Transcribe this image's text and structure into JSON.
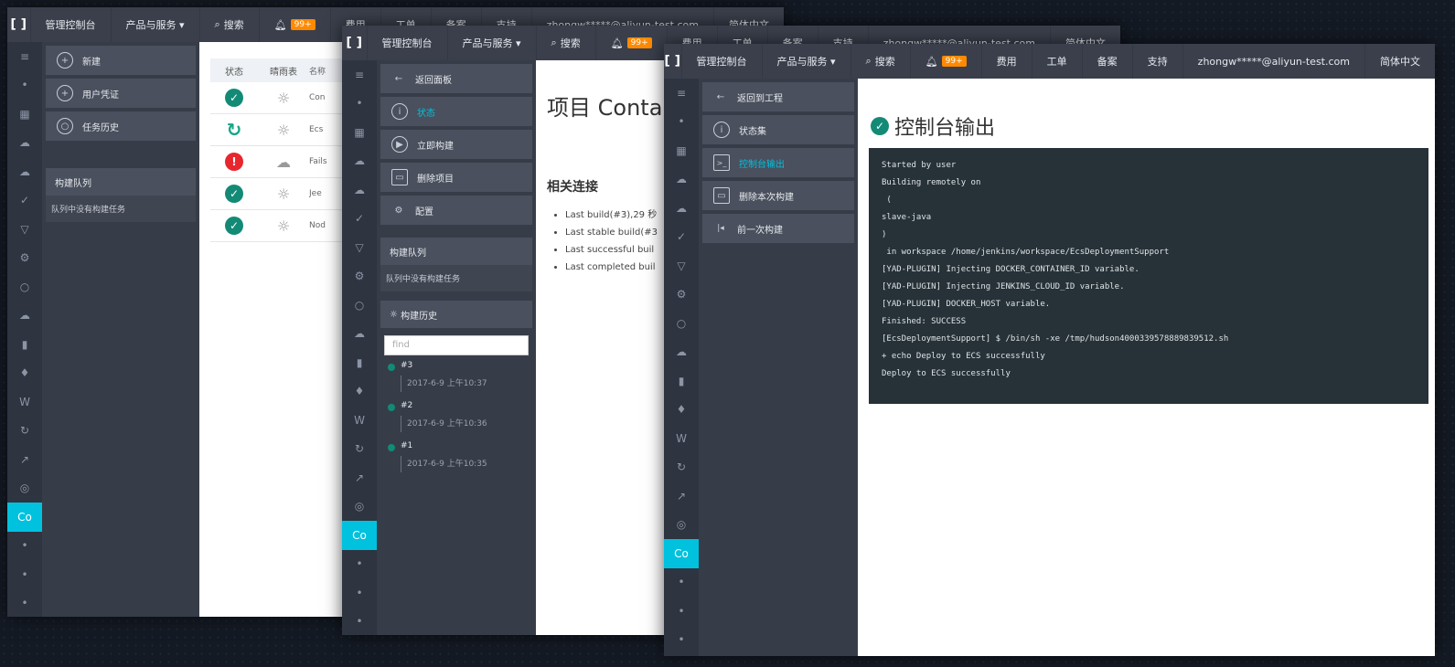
{
  "topbar": {
    "logo": "[ ]",
    "console": "管理控制台",
    "products": "产品与服务 ▾",
    "search": "搜索",
    "badge": "99+",
    "fees": "费用",
    "tickets": "工单",
    "records": "备案",
    "support": "支持",
    "user": "zhongw*****@aliyun-test.com",
    "lang": "简体中文"
  },
  "win1": {
    "nav": [
      {
        "icon": "+",
        "label": "新建"
      },
      {
        "icon": "+",
        "label": "用户凭证"
      },
      {
        "icon": "○",
        "label": "任务历史"
      }
    ],
    "queue_title": "构建队列",
    "queue_empty": "队列中没有构建任务",
    "table": {
      "headers": [
        "状态",
        "晴雨表",
        "名称"
      ],
      "rows": [
        {
          "status": "ok",
          "status_glyph": "✓",
          "weather": "☼",
          "name": "Con"
        },
        {
          "status": "run",
          "status_glyph": "↻",
          "weather": "☼",
          "name": "Ecs"
        },
        {
          "status": "fail",
          "status_glyph": "!",
          "weather": "☁",
          "name": "Fails"
        },
        {
          "status": "ok",
          "status_glyph": "✓",
          "weather": "☼",
          "name": "Jee"
        },
        {
          "status": "ok",
          "status_glyph": "✓",
          "weather": "☼",
          "name": "Nod"
        }
      ]
    }
  },
  "win2": {
    "nav": [
      {
        "icon": "←",
        "label": "返回面板"
      },
      {
        "icon": "i",
        "label": "状态"
      },
      {
        "icon": "▶",
        "label": "立即构建"
      },
      {
        "icon": "▭",
        "label": "删除项目"
      },
      {
        "icon": "⚙",
        "label": "配置"
      }
    ],
    "queue_title": "构建队列",
    "queue_empty": "队列中没有构建任务",
    "history_title": "构建历史",
    "find_placeholder": "find",
    "history": [
      {
        "num": "#3",
        "date": "2017-6-9 上午10:37"
      },
      {
        "num": "#2",
        "date": "2017-6-9 上午10:36"
      },
      {
        "num": "#1",
        "date": "2017-6-9 上午10:35"
      }
    ],
    "title": "项目 Contai",
    "related_title": "相关连接",
    "related": [
      "Last build(#3),29 秒",
      "Last stable build(#3",
      "Last successful buil",
      "Last completed buil"
    ]
  },
  "win3": {
    "nav": [
      {
        "icon": "←",
        "label": "返回到工程"
      },
      {
        "icon": "i",
        "label": "状态集"
      },
      {
        "icon": ">_",
        "label": "控制台输出"
      },
      {
        "icon": "▭",
        "label": "删除本次构建"
      },
      {
        "icon": "|◂",
        "label": "前一次构建"
      }
    ],
    "title": "控制台输出",
    "console_lines": [
      "Started by user",
      "Building remotely on",
      " (",
      "slave-java",
      ")",
      " in workspace /home/jenkins/workspace/EcsDeploymentSupport",
      "[YAD-PLUGIN] Injecting DOCKER_CONTAINER_ID variable.",
      "[YAD-PLUGIN] Injecting JENKINS_CLOUD_ID variable.",
      "[YAD-PLUGIN] DOCKER_HOST variable.",
      "Finished: SUCCESS",
      "[EcsDeploymentSupport] $ /bin/sh -xe /tmp/hudson4000339578889839512.sh",
      "+ echo Deploy to ECS successfully",
      "Deploy to ECS successfully"
    ]
  },
  "rail_icons": [
    "≡",
    "•",
    "▦",
    "☁",
    "☁",
    "✓",
    "▽",
    "⚙",
    "○",
    "☁",
    "▮",
    "♦",
    "W",
    "↻",
    "↗",
    "◎",
    "Co",
    "•",
    "•",
    "•"
  ]
}
